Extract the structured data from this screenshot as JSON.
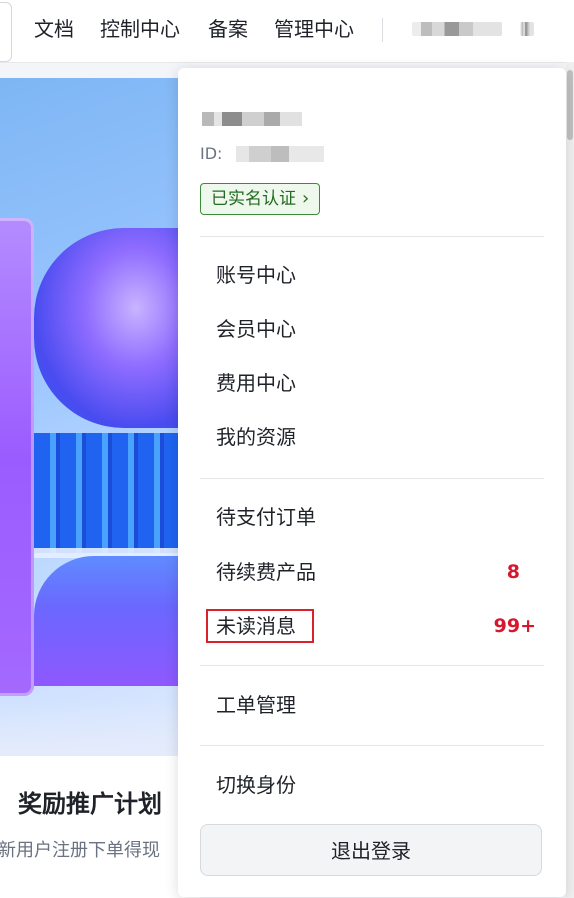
{
  "nav": {
    "items": [
      "文档",
      "控制中心",
      "备案",
      "管理中心"
    ]
  },
  "banner": {
    "title": "奖励推广计划",
    "subtitle": "新用户注册下单得现"
  },
  "account_menu": {
    "id_label": "ID:",
    "verified_badge": "已实名认证",
    "section1": [
      "账号中心",
      "会员中心",
      "费用中心",
      "我的资源"
    ],
    "pending_orders": "待支付订单",
    "renewal": {
      "label": "待续费产品",
      "count": "8"
    },
    "unread": {
      "label": "未读消息",
      "count": "99+"
    },
    "tickets": "工单管理",
    "switch_identity": "切换身份",
    "logout": "退出登录"
  },
  "colors": {
    "accent_red": "#d6172e",
    "verified_green": "#236b22",
    "highlight_border": "#d9222a"
  }
}
